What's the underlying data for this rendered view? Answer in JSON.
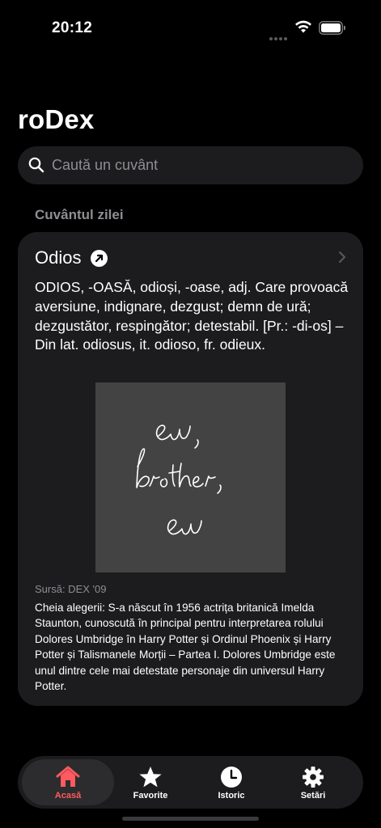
{
  "status_bar": {
    "time": "20:12",
    "signal_icon": "signal-dots-icon",
    "wifi_icon": "wifi-icon",
    "battery_icon": "battery-icon"
  },
  "app": {
    "title": "roDex"
  },
  "search": {
    "placeholder": "Caută un cuvânt",
    "value": "",
    "icon": "search-icon"
  },
  "word_of_day": {
    "section_title": "Cuvântul zilei",
    "word": "Odios",
    "share_icon": "arrow-up-right-circle-icon",
    "chevron_icon": "chevron-right-icon",
    "definition": "ODIOS, -OASĂ, odioși, -oase, adj. Care provoacă aversiune, indignare, dezgust; demn de ură; dezgustător, respingător; detestabil. [Pr.: -di-os] – Din lat. odiosus, it. odioso, fr. odieux.",
    "image": {
      "lines": [
        "ew,",
        "brother,",
        "ew"
      ],
      "background": "#434343"
    },
    "source": "Sursă: DEX '09",
    "explanation": "Cheia alegerii: S-a născut în 1956 actrița britanică Imelda Staunton, cunoscută în principal pentru interpretarea rolului Dolores Umbridge în Harry Potter și Ordinul Phoenix și Harry Potter și Talismanele Morții – Partea I. Dolores Umbridge este unul dintre cele mai detestate personaje din universul Harry Potter."
  },
  "tab_bar": {
    "tabs": [
      {
        "label": "Acasă",
        "icon": "house-icon",
        "active": true
      },
      {
        "label": "Favorite",
        "icon": "star-icon",
        "active": false
      },
      {
        "label": "Istoric",
        "icon": "clock-icon",
        "active": false
      },
      {
        "label": "Setări",
        "icon": "gear-icon",
        "active": false
      }
    ]
  },
  "colors": {
    "background": "#000000",
    "card": "#1c1c1e",
    "secondary_text": "#8e8e93",
    "accent": "#ff5a5f"
  }
}
